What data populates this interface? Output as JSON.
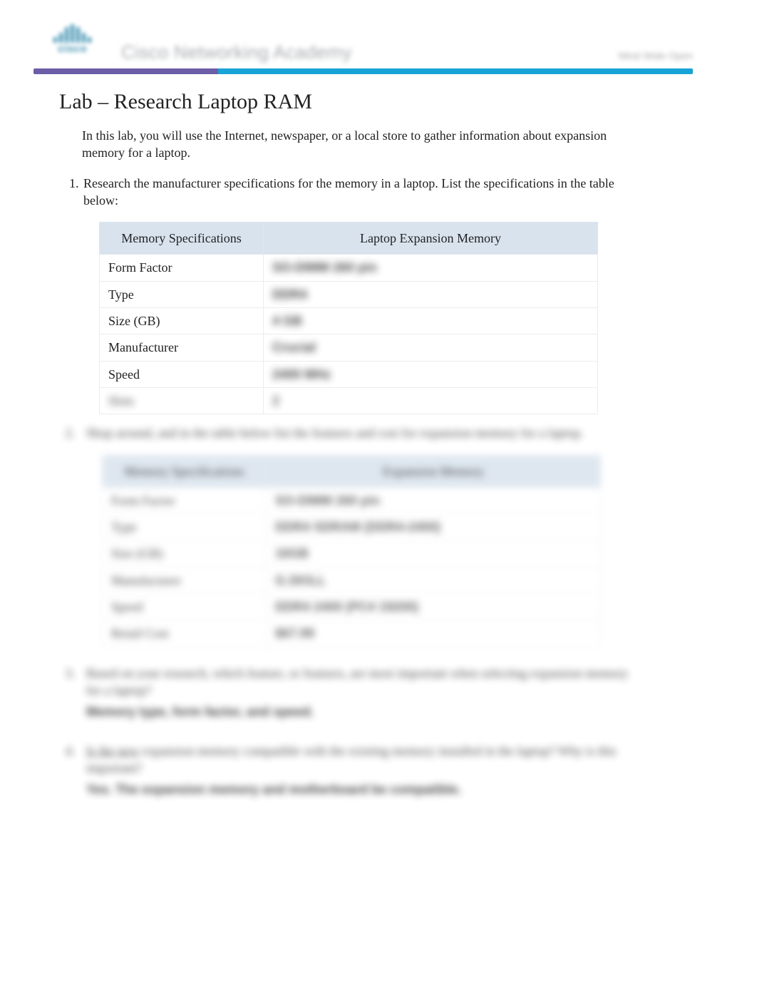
{
  "header": {
    "logo_word": "cisco",
    "program_name": "Cisco Networking Academy",
    "tagline": "Mind Wide Open"
  },
  "title": "Lab – Research Laptop RAM",
  "intro": "In this lab, you will use the Internet, newspaper, or a local store to gather information about expansion memory for a laptop.",
  "steps": [
    {
      "num": "1.",
      "text": "Research the manufacturer specifications for the memory in a laptop. List the specifications in the table below:"
    },
    {
      "num": "2.",
      "text": "Shop around, and in the table below list the features and cost for expansion memory for a laptop."
    },
    {
      "num": "3.",
      "text": "Based on your research, which feature, or features, are most important when selecting expansion memory for a laptop?",
      "answer": "Memory type, form factor, and speed."
    },
    {
      "num": "4.",
      "text_prefix": "Is the new",
      "text_rest": " expansion memory compatible with the existing memory installed in the laptop? Why is this important?",
      "answer": "Yes. The expansion memory and motherboard be compatible."
    }
  ],
  "table1": {
    "col1": "Memory Specifications",
    "col2": "Laptop Expansion Memory",
    "rows": [
      {
        "label": "Form Factor",
        "value": "SO-DIMM 260 pin"
      },
      {
        "label": "Type",
        "value": "DDR4"
      },
      {
        "label": "Size (GB)",
        "value": "4 GB"
      },
      {
        "label": "Manufacturer",
        "value": "Crucial"
      },
      {
        "label": "Speed",
        "value": "2400 MHz"
      },
      {
        "label": "Slots",
        "value": "2"
      }
    ]
  },
  "table2": {
    "col1": "Memory Specifications",
    "col2": "Expansion Memory",
    "rows": [
      {
        "label": "Form Factor",
        "value": "SO-DIMM 260 pin"
      },
      {
        "label": "Type",
        "value": "DDR4 SDRAM (DDR4-2400)"
      },
      {
        "label": "Size (GB)",
        "value": "16GB"
      },
      {
        "label": "Manufacturer",
        "value": "G.SKILL"
      },
      {
        "label": "Speed",
        "value": "DDR4 2400 (PC4 19200)"
      },
      {
        "label": "Retail Cost",
        "value": "$67.99"
      }
    ]
  }
}
